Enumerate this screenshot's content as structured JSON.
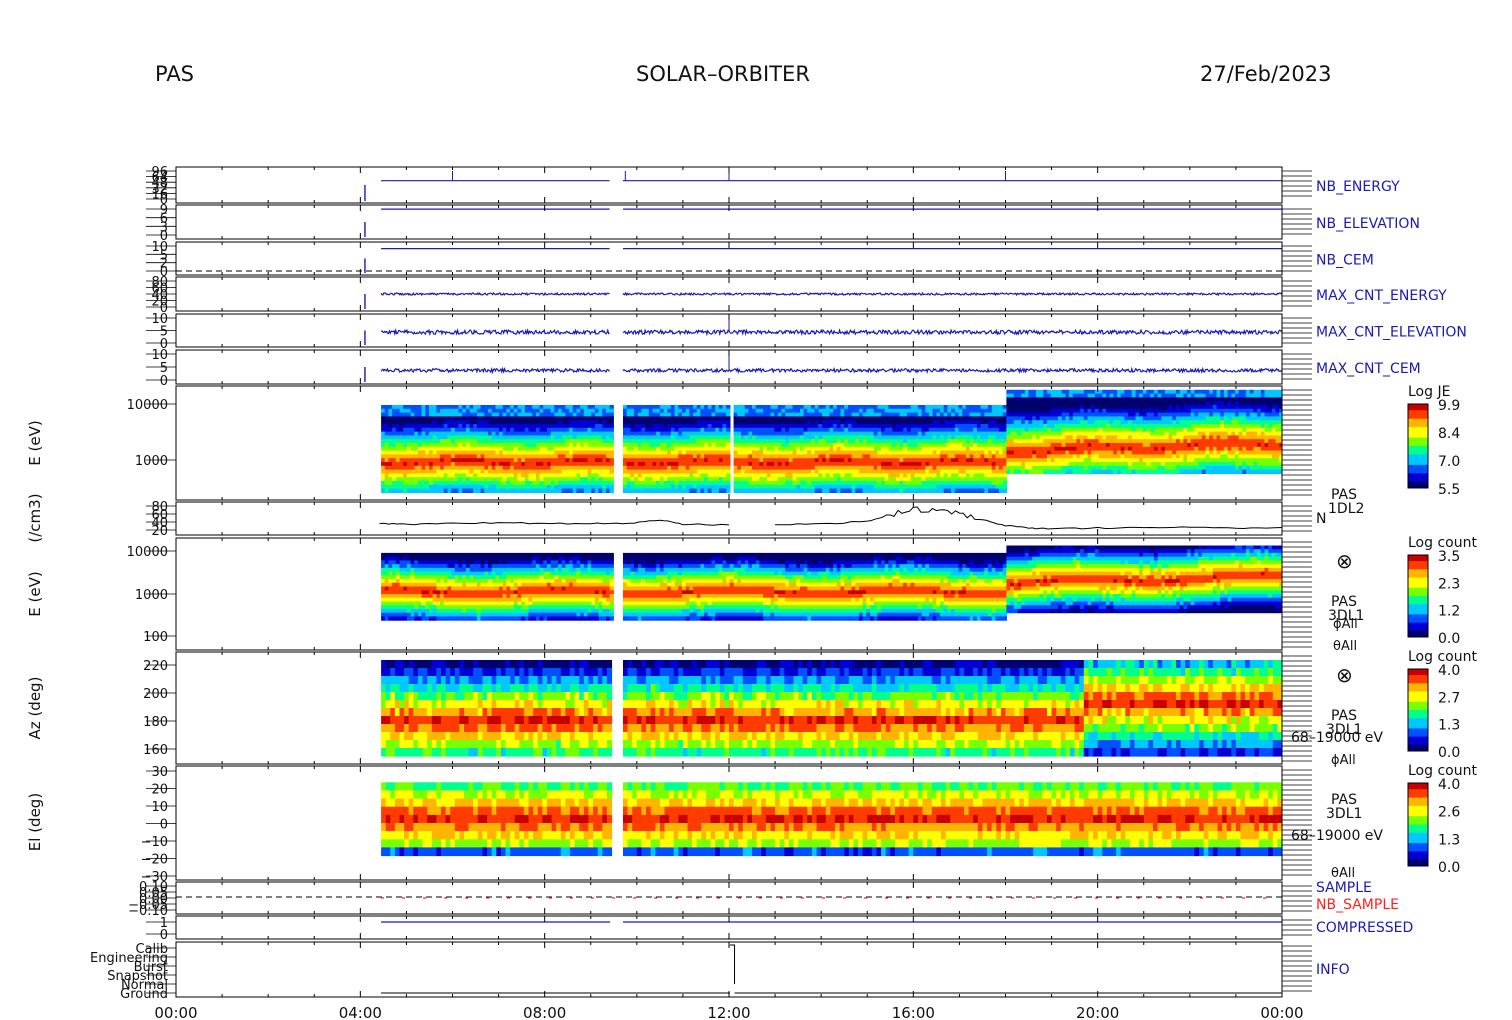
{
  "header": {
    "left": "PAS",
    "center": "SOLAR–ORBITER",
    "right": "27/Feb/2023"
  },
  "colors": {
    "hk_blue": "#1a1ab4",
    "sample_red": "#ff2020",
    "colormap": [
      "#00006e",
      "#0000d2",
      "#0050ff",
      "#00c8ff",
      "#00ff8c",
      "#78ff00",
      "#ffff00",
      "#ffb400",
      "#ff3c00",
      "#c80000"
    ]
  },
  "chart_data": [
    {
      "id": "nb_energy",
      "type": "line",
      "label": "NB_ENERGY",
      "yticks": [
        "96",
        "64",
        "48",
        "32",
        "16",
        "0"
      ],
      "description_values": "step trace near 96"
    },
    {
      "id": "nb_elevation",
      "type": "line",
      "label": "NB_ELEVATION",
      "yticks": [
        "9",
        "6",
        "3",
        "0"
      ]
    },
    {
      "id": "nb_cem",
      "type": "line",
      "label": "NB_CEM",
      "yticks": [
        "10",
        "5",
        "2",
        "0"
      ]
    },
    {
      "id": "max_cnt_energy",
      "type": "line",
      "label": "MAX_CNT_ENERGY",
      "yticks": [
        "80",
        "60",
        "40",
        "20",
        "0"
      ]
    },
    {
      "id": "max_cnt_elevation",
      "type": "line",
      "label": "MAX_CNT_ELEVATION",
      "yticks": [
        "10",
        "5",
        "0"
      ]
    },
    {
      "id": "max_cnt_cem",
      "type": "line",
      "label": "MAX_CNT_CEM",
      "yticks": [
        "10",
        "5",
        "0"
      ]
    },
    {
      "id": "je_spectrogram",
      "type": "heatmap",
      "ylabel": "E (eV)",
      "yscale": "log",
      "yticks": [
        "10000",
        "1000"
      ],
      "colorbar_title": "Log JE",
      "colorbar_ticks": [
        "9.9",
        "8.4",
        "7.0",
        "5.5"
      ],
      "zlim": [
        5.5,
        9.9
      ]
    },
    {
      "id": "density",
      "type": "line",
      "ylabel": "(/cm3)",
      "yticks": [
        "80",
        "60",
        "40",
        "20"
      ],
      "label": "N",
      "tag": [
        "PAS",
        "1DL2"
      ],
      "x": [
        "04:25",
        "05:00",
        "06:00",
        "07:00",
        "08:00",
        "09:00",
        "09:50",
        "10:30",
        "11:00",
        "12:00",
        "13:00",
        "14:00",
        "15:00",
        "15:30",
        "16:00",
        "16:30",
        "17:00",
        "17:30",
        "18:00",
        "18:30",
        "19:00",
        "20:00",
        "21:00",
        "22:00",
        "23:00",
        "24:00"
      ],
      "y": [
        30,
        28,
        30,
        32,
        30,
        30,
        30,
        38,
        28,
        27,
        28,
        29,
        35,
        50,
        62,
        58,
        50,
        38,
        25,
        20,
        18,
        20,
        22,
        22,
        20,
        20
      ]
    },
    {
      "id": "count_spectrogram",
      "type": "heatmap",
      "ylabel": "E (eV)",
      "yscale": "log",
      "yticks": [
        "10000",
        "1000",
        "100"
      ],
      "colorbar_title": "Log count",
      "colorbar_ticks": [
        "3.5",
        "2.3",
        "1.2",
        "0.0"
      ],
      "zlim": [
        0.0,
        3.5
      ],
      "tag": [
        "PAS",
        "3DL1"
      ],
      "phi": "ϕAll",
      "theta": "θAll"
    },
    {
      "id": "azimuth",
      "type": "heatmap",
      "ylabel": "Az (deg)",
      "yticks": [
        "220",
        "200",
        "180",
        "160"
      ],
      "colorbar_title": "Log count",
      "colorbar_ticks": [
        "4.0",
        "2.7",
        "1.3",
        "0.0"
      ],
      "zlim": [
        0.0,
        4.0
      ],
      "tag": [
        "PAS",
        "3DL1"
      ],
      "energy_range": "68–19000 eV",
      "phi": "ϕAll"
    },
    {
      "id": "elevation",
      "type": "heatmap",
      "ylabel": "El (deg)",
      "yticks": [
        "30",
        "20",
        "10",
        "0",
        "−10",
        "−20",
        "−30"
      ],
      "colorbar_title": "Log count",
      "colorbar_ticks": [
        "4.0",
        "2.6",
        "1.3",
        "0.0"
      ],
      "zlim": [
        0.0,
        4.0
      ],
      "tag": [
        "PAS",
        "3DL1"
      ],
      "energy_range": "68–19000 eV",
      "theta": "θAll"
    },
    {
      "id": "sample",
      "type": "line",
      "yticks": [
        "0.10",
        "0.05",
        "0.00",
        "−0.05",
        "−0.10"
      ],
      "labels": [
        "SAMPLE",
        "NB_SAMPLE"
      ]
    },
    {
      "id": "compressed",
      "type": "line",
      "yticks": [
        "1",
        "0"
      ],
      "label": "COMPRESSED"
    },
    {
      "id": "info",
      "type": "line",
      "yticks": [
        "Calib",
        "Engineering",
        "Burst",
        "Snapshot",
        "Normal",
        "Ground"
      ],
      "label": "INFO"
    }
  ],
  "xaxis": {
    "ticks": [
      "00:00",
      "04:00",
      "08:00",
      "12:00",
      "16:00",
      "20:00",
      "00:00"
    ],
    "range_hours": [
      0,
      24
    ]
  }
}
